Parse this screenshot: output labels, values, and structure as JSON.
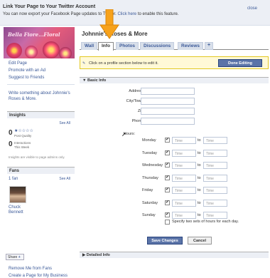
{
  "notice": {
    "title": "Link Your Page to Your Twitter Account",
    "text_before": "You can now export your Facebook Page updates to Twitter.",
    "link_text": "Click here",
    "text_after": "to enable this feature.",
    "close": "close"
  },
  "sidebar": {
    "banner_text": "Bella Fiore...Floral",
    "links": [
      "Edit Page",
      "Promote with an Ad",
      "Suggest to Friends"
    ],
    "write_something": [
      "Write something about Johnnie's",
      "Roses & More."
    ],
    "insights": {
      "title": "Insights",
      "see_all": "See All",
      "quality_value": "0",
      "quality_label": "Post Quality",
      "interactions_value": "0",
      "interactions_label_1": "Interactions",
      "interactions_label_2": "This Week",
      "note": "Insights are visible to page admins only."
    },
    "fans": {
      "title": "Fans",
      "count": "1 fan",
      "see_all": "See All",
      "fan_name_first": "Chuck",
      "fan_name_last": "Bennett"
    },
    "bottom_links": [
      "Remove Me from Fans",
      "Create a Page for My Business"
    ],
    "share": "Share"
  },
  "main": {
    "page_title": "Johnnie's Roses & More",
    "tabs": [
      "Wall",
      "Info",
      "Photos",
      "Discussions",
      "Reviews",
      "+"
    ],
    "active_tab": "Info",
    "edit_hint": "Click on a profile section below to edit it.",
    "done_editing": "Done Editing",
    "basic_info": "Basic Info",
    "detailed_info": "Detailed Info",
    "fields": [
      "Address:",
      "City/Town:",
      "Zip:",
      "Phone:"
    ],
    "hours_label": "Hours:",
    "days": [
      "Monday",
      "Tuesday",
      "Wednesday",
      "Thursday",
      "Friday",
      "Saturday",
      "Sunday"
    ],
    "time_placeholder": "Time",
    "to_label": "to",
    "two_sets": "Specify two sets of hours for each day.",
    "save": "Save Changes",
    "cancel": "Cancel"
  },
  "colors": {
    "facebook_blue": "#3b5998",
    "highlight_arrow": "#f7a21b"
  }
}
